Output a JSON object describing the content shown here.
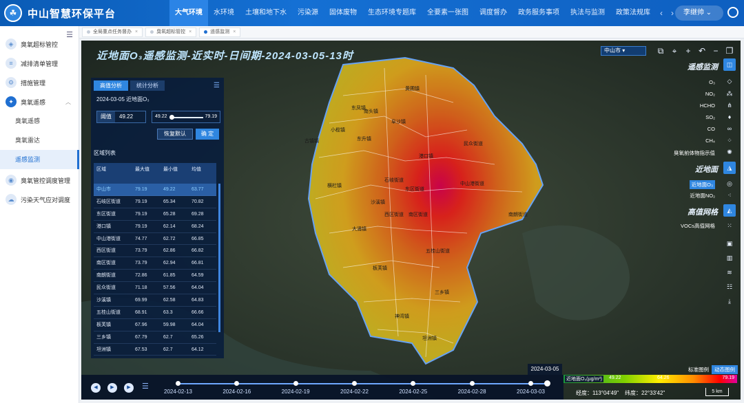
{
  "app": {
    "title": "中山智慧环保平台",
    "user": "李继帅"
  },
  "nav": [
    "大气环境",
    "水环境",
    "土壤和地下水",
    "污染源",
    "固体废物",
    "生态环境专题库",
    "全要素一张图",
    "调度督办",
    "政务服务事项",
    "执法与监测",
    "政策法规库"
  ],
  "sidebar": {
    "menu1": "臭氧超标管控",
    "menu2": "减排清单管理",
    "menu3": "措施管理",
    "menu4": "臭氧遥感",
    "sub1": "臭氧遥感",
    "sub2": "臭氧雷达",
    "sub3": "遥感监测",
    "menu5": "臭氧管控调度管理",
    "menu6": "污染天气应对调度"
  },
  "tabs": [
    "全局重点任务督办",
    "臭氧超标管控",
    "遥感监测"
  ],
  "map": {
    "title": "近地面O₃遥感监测-近实时-日间期-2024-03-05-13时",
    "city": "中山市",
    "panel": {
      "tab1": "高值分析",
      "tab2": "统计分析",
      "date": "2024-03-05  近地面O₃",
      "threshold_label": "阈值",
      "threshold_value": "49.22",
      "slider_min": "49.22",
      "slider_max": "79.19",
      "reset_label": "恢复默认",
      "ok_label": "确 定",
      "list_title": "区域列表",
      "columns": [
        "区域",
        "最大值",
        "最小值",
        "均值"
      ],
      "rows": [
        [
          "中山市",
          "79.19",
          "49.22",
          "63.77"
        ],
        [
          "石岐区街道",
          "79.19",
          "65.34",
          "70.82"
        ],
        [
          "东区街道",
          "79.19",
          "65.28",
          "69.28"
        ],
        [
          "港口镇",
          "79.19",
          "62.14",
          "68.24"
        ],
        [
          "中山港街道",
          "74.77",
          "62.72",
          "66.85"
        ],
        [
          "西区街道",
          "73.79",
          "62.86",
          "66.82"
        ],
        [
          "南区街道",
          "73.79",
          "62.94",
          "66.81"
        ],
        [
          "南朗街道",
          "72.86",
          "61.85",
          "64.59"
        ],
        [
          "民众街道",
          "71.18",
          "57.56",
          "64.04"
        ],
        [
          "沙溪镇",
          "69.99",
          "62.58",
          "64.83"
        ],
        [
          "五桂山街道",
          "68.91",
          "63.3",
          "66.66"
        ],
        [
          "板芙镇",
          "67.96",
          "59.98",
          "64.04"
        ],
        [
          "三乡镇",
          "67.79",
          "62.7",
          "65.26"
        ],
        [
          "坦洲镇",
          "67.53",
          "62.7",
          "64.12"
        ]
      ]
    },
    "right": {
      "remote_title": "遥感监测",
      "pollutants": [
        "O₃",
        "NO₂",
        "HCHO",
        "SO₂",
        "CO",
        "CH₄",
        "臭氧前体物指示值"
      ],
      "surface_title": "近地面",
      "surface_items": [
        "近地面O₃",
        "近地面NO₂"
      ],
      "grid_title": "高值网格",
      "grid_items": [
        "VOCs高值网格"
      ]
    },
    "regions": [
      "黄圃镇",
      "南头镇",
      "东凤镇",
      "阜沙镇",
      "小榄镇",
      "东升镇",
      "古镇镇",
      "横栏镇",
      "港口镇",
      "民众街道",
      "石岐街道",
      "东区街道",
      "中山港街道",
      "沙溪镇",
      "大涌镇",
      "西区街道",
      "南区街道",
      "南朗街道",
      "五桂山街道",
      "板芙镇",
      "三乡镇",
      "神湾镇",
      "坦洲镇"
    ],
    "timeline": {
      "dates": [
        "2024-02-13",
        "2024-02-16",
        "2024-02-19",
        "2024-02-22",
        "2024-02-25",
        "2024-02-28",
        "2024-03-03"
      ],
      "current": "2024-03-05"
    },
    "legend": {
      "modes": [
        "标准图例",
        "动态图例"
      ],
      "label": "近地面O₃(µg/m³)",
      "min": "49.22",
      "mid": "64.26",
      "max": "79.19"
    },
    "coords": {
      "lon_label": "经度：",
      "lon": "113°04'49\"",
      "lat_label": "纬度：",
      "lat": "22°33'42\""
    },
    "scale": "5 km"
  }
}
